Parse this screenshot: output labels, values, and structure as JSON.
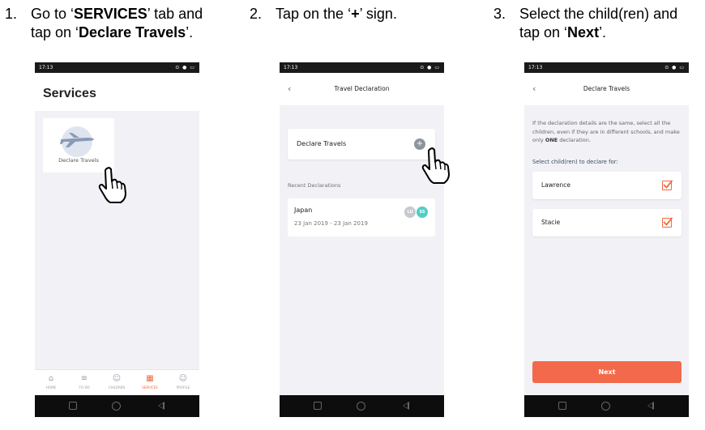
{
  "steps": [
    {
      "num": "1.",
      "line1_pre": "Go to ‘",
      "line1_bold": "SERVICES",
      "line1_post": "’ tab and",
      "line2_pre": "tap on ‘",
      "line2_bold": "Declare Travels",
      "line2_post": "’."
    },
    {
      "num": "2.",
      "line1_pre": "Tap on the ‘",
      "line1_bold": "+",
      "line1_post": "’ sign."
    },
    {
      "num": "3.",
      "line1_pre": "Select the child(ren) and",
      "line2_pre": "tap on ‘",
      "line2_bold": "Next",
      "line2_post": "’."
    }
  ],
  "statusbar": {
    "time": "17:13",
    "icons": "⊙ ● ▭"
  },
  "phone1": {
    "title": "Services",
    "card_label": "Declare Travels",
    "tabs": [
      {
        "label": "HOME",
        "icon": "home-icon",
        "glyph": "⌂"
      },
      {
        "label": "TO-DO",
        "icon": "list-icon",
        "glyph": "≡"
      },
      {
        "label": "CHILDREN",
        "icon": "child-icon",
        "glyph": "☺"
      },
      {
        "label": "SERVICES",
        "icon": "grid-icon",
        "glyph": "▦"
      },
      {
        "label": "PROFILE",
        "icon": "person-icon",
        "glyph": "☺"
      }
    ]
  },
  "phone2": {
    "title": "Travel Declaration",
    "declare_label": "Declare Travels",
    "plus": "+",
    "section": "Recent Declarations",
    "card": {
      "name": "Japan",
      "dates": "23 Jan 2019 - 23 Jan 2019",
      "avatars": [
        "LU",
        "SS"
      ]
    }
  },
  "phone3": {
    "title": "Declare Travels",
    "info_pre": "If the declaration details are the same, select all the children, even if they are in different schools, and make only ",
    "info_bold": "ONE",
    "info_post": " declaration.",
    "select_label": "Select child(ren) to declare for:",
    "children": [
      "Lawrence",
      "Stacie"
    ],
    "next": "Next"
  },
  "colors": {
    "accent": "#f26a4b",
    "teal": "#4fcfc6"
  }
}
